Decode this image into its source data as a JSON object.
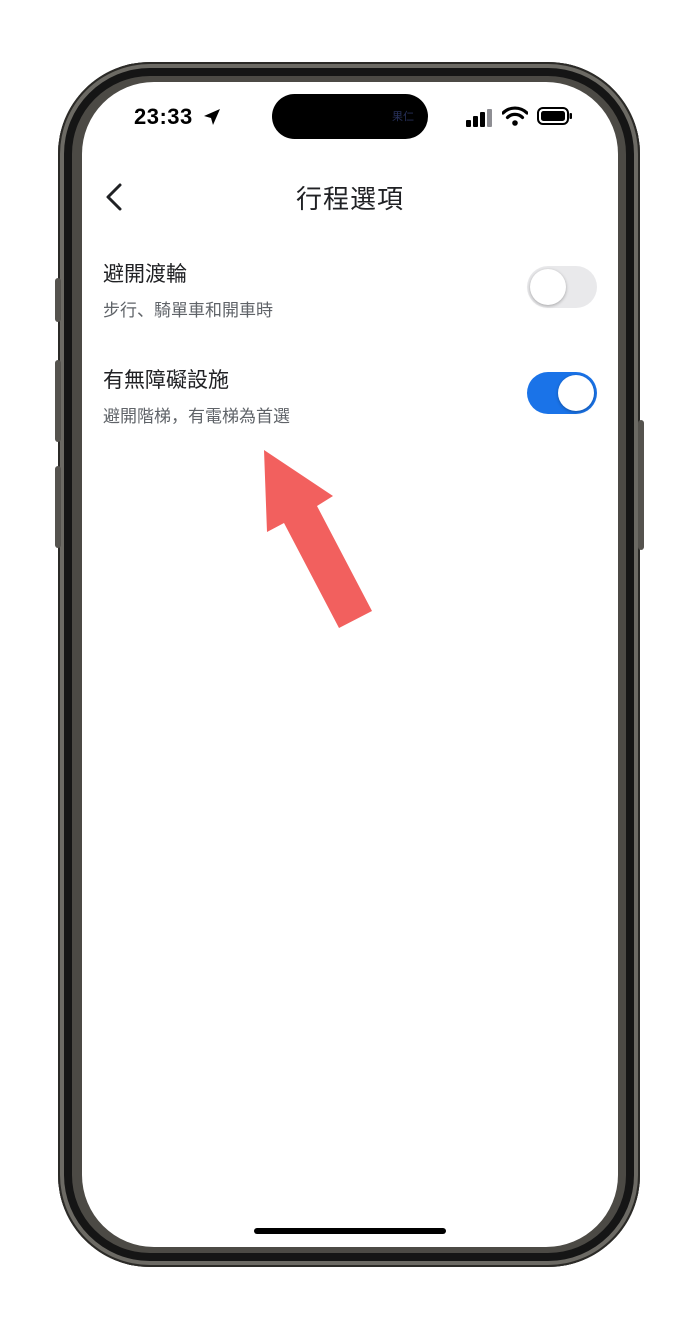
{
  "status_bar": {
    "time": "23:33"
  },
  "dynamic_island": {
    "text": "果仁"
  },
  "header": {
    "title": "行程選項"
  },
  "options": [
    {
      "title": "避開渡輪",
      "subtitle": "步行、騎單車和開車時",
      "enabled": false
    },
    {
      "title": "有無障礙設施",
      "subtitle": "避開階梯，有電梯為首選",
      "enabled": true
    }
  ],
  "colors": {
    "accent": "#1a73e8",
    "toggle_off": "#e9e9eb",
    "annotation_arrow": "#f2605e"
  },
  "icons": [
    "location-arrow-icon",
    "signal-icon",
    "wifi-icon",
    "battery-icon",
    "back-chevron-icon"
  ]
}
